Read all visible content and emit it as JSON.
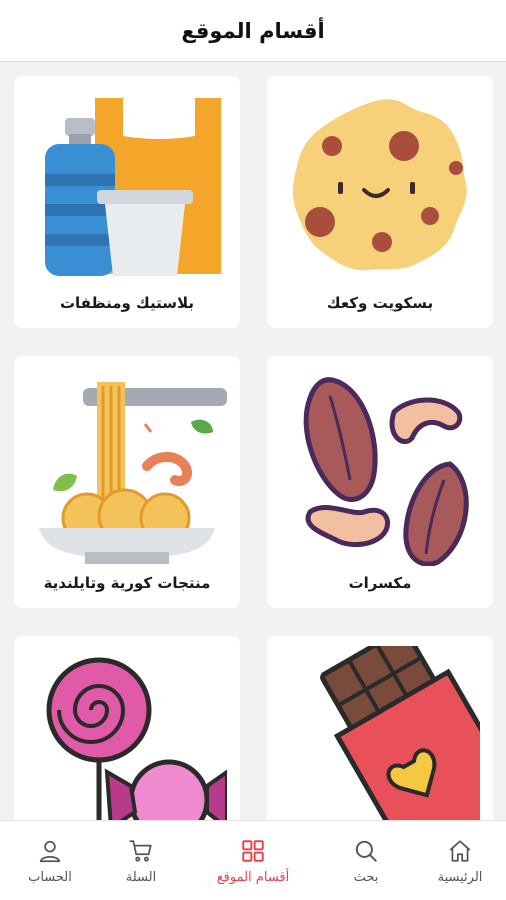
{
  "header": {
    "title": "أقسام الموقع"
  },
  "categories": [
    {
      "label": "بسكويت وكعك",
      "icon": "cookie-icon"
    },
    {
      "label": "بلاستيك ومنظفات",
      "icon": "plastic-cleaners-icon"
    },
    {
      "label": "مكسرات",
      "icon": "nuts-icon"
    },
    {
      "label": "منتجات كورية وتايلندية",
      "icon": "noodles-icon"
    },
    {
      "label": "",
      "icon": "chocolate-bar-icon"
    },
    {
      "label": "",
      "icon": "candy-icon"
    }
  ],
  "nav": {
    "items": [
      {
        "label": "الرئيسية",
        "icon": "home-icon"
      },
      {
        "label": "بحث",
        "icon": "search-icon"
      },
      {
        "label": "أقسام الموقع",
        "icon": "grid-icon",
        "active": true
      },
      {
        "label": "السلة",
        "icon": "cart-icon"
      },
      {
        "label": "الحساب",
        "icon": "user-icon"
      }
    ]
  },
  "colors": {
    "accent": "#e8434b",
    "background": "#f2f2f4",
    "card": "#ffffff"
  }
}
